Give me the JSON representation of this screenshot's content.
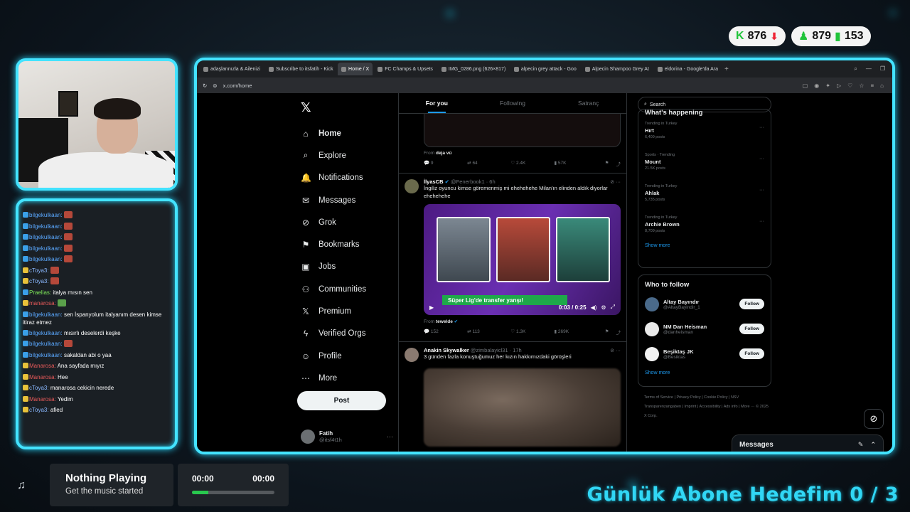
{
  "stats": {
    "kick_count": "876",
    "followers": "879",
    "viewers": "153"
  },
  "chat": {
    "lines": [
      {
        "user": "bilgekulkaan:",
        "text": "",
        "ucls": "u-blue",
        "emote": true
      },
      {
        "user": "bilgekulkaan:",
        "text": "",
        "ucls": "u-blue",
        "emote": true
      },
      {
        "user": "bilgekulkaan:",
        "text": "",
        "ucls": "u-blue",
        "emote": true
      },
      {
        "user": "bilgekulkaan:",
        "text": "",
        "ucls": "u-blue",
        "emote": true
      },
      {
        "user": "bilgekulkaan:",
        "text": "",
        "ucls": "u-blue",
        "emote": true
      },
      {
        "user": "cToya3:",
        "text": "",
        "ucls": "u-lblue",
        "emote": true
      },
      {
        "user": "cToya3:",
        "text": "",
        "ucls": "u-lblue",
        "emote": true
      },
      {
        "user": "Praelias:",
        "text": "italya mısın sen",
        "ucls": "u-green",
        "emote": false
      },
      {
        "user": "manarosa:",
        "text": "",
        "ucls": "u-red",
        "emote": true
      },
      {
        "user": "bilgekulkaan:",
        "text": "sen İspanyolum italyanım desen kimse itiraz etmez",
        "ucls": "u-blue",
        "emote": false,
        "wrap": true
      },
      {
        "user": "bilgekulkaan:",
        "text": "mısırlı deselerdi keşke",
        "ucls": "u-blue",
        "emote": false
      },
      {
        "user": "bilgekulkaan:",
        "text": "",
        "ucls": "u-blue",
        "emote": true
      },
      {
        "user": "bilgekulkaan:",
        "text": "sakaldan abi o yaa",
        "ucls": "u-blue",
        "emote": false
      },
      {
        "user": "Manarosa:",
        "text": "Ana sayfada mıyız",
        "ucls": "u-red",
        "emote": false
      },
      {
        "user": "Manarosa:",
        "text": "Hee",
        "ucls": "u-red",
        "emote": false
      },
      {
        "user": "cToya3:",
        "text": "manarosa cekicin nerede",
        "ucls": "u-lblue",
        "emote": false
      },
      {
        "user": "Manarosa:",
        "text": "Yedim",
        "ucls": "u-red",
        "emote": false
      },
      {
        "user": "cToya3:",
        "text": "afied",
        "ucls": "u-lblue",
        "emote": false
      }
    ]
  },
  "music": {
    "title": "Nothing Playing",
    "subtitle": "Get the music started",
    "time_current": "00:00",
    "time_total": "00:00",
    "progress": 0.2
  },
  "goal_text": "Günlük Abone Hedefim  0 / 3",
  "browser": {
    "tabs": [
      {
        "label": "adaşlarınızla & Ailenizi",
        "active": false
      },
      {
        "label": "Subscribe to itsfatih - Kick",
        "active": false
      },
      {
        "label": "Home / X",
        "active": true
      },
      {
        "label": "FC Champs & Upsets",
        "active": false
      },
      {
        "label": "IMG_0286.png (626×817)",
        "active": false
      },
      {
        "label": "alpecin grey attack - Goo",
        "active": false
      },
      {
        "label": "Alpecin Shampoo Grey At",
        "active": false
      },
      {
        "label": "eldorina - Google'da Ara",
        "active": false
      }
    ],
    "url": "x.com/home"
  },
  "x": {
    "nav": [
      {
        "label": "Home",
        "icon": "home-icon",
        "glyph": "⌂",
        "active": true
      },
      {
        "label": "Explore",
        "icon": "search-icon",
        "glyph": "⌕"
      },
      {
        "label": "Notifications",
        "icon": "bell-icon",
        "glyph": "🔔"
      },
      {
        "label": "Messages",
        "icon": "mail-icon",
        "glyph": "✉"
      },
      {
        "label": "Grok",
        "icon": "grok-icon",
        "glyph": "⊘"
      },
      {
        "label": "Bookmarks",
        "icon": "bookmark-icon",
        "glyph": "⚑"
      },
      {
        "label": "Jobs",
        "icon": "briefcase-icon",
        "glyph": "▣"
      },
      {
        "label": "Communities",
        "icon": "communities-icon",
        "glyph": "⚇"
      },
      {
        "label": "Premium",
        "icon": "x-icon",
        "glyph": "𝕏"
      },
      {
        "label": "Verified Orgs",
        "icon": "lightning-icon",
        "glyph": "ϟ"
      },
      {
        "label": "Profile",
        "icon": "person-icon",
        "glyph": "☺"
      },
      {
        "label": "More",
        "icon": "more-icon",
        "glyph": "⋯"
      }
    ],
    "post_button": "Post",
    "profile": {
      "name": "Fatih",
      "handle": "@itsf4t1h"
    },
    "tabs": [
      "For you",
      "Following",
      "Satranç"
    ],
    "top_post": {
      "from": "deja vú",
      "replies": "9",
      "reposts": "64",
      "likes": "2.4K",
      "views": "57K"
    },
    "post1": {
      "name": "İlyasCB",
      "handle": "@Fenerbook1 · 6h",
      "text": "İngiliz oyuncu kimse göremenmiş mi ehehehehe Milan'ın elinden aldık diyorlar ehehehehe",
      "banner": "Süper Lig'de transfer yarışı!",
      "video_time": "0:03 / 0:25",
      "from": "tewelde",
      "replies": "152",
      "reposts": "113",
      "likes": "1.3K",
      "views": "269K"
    },
    "post2": {
      "name": "Anakin Skywalker",
      "handle": "@zimbalayicl31 · 17h",
      "text": "3 günden fazla konuştuğumuz her kızın hakkımızdaki görüşleri"
    },
    "search_placeholder": "Search",
    "happening_title": "What's happening",
    "trends": [
      {
        "meta": "Trending in Turkey",
        "name": "Hırt",
        "count": "6,409 posts"
      },
      {
        "meta": "Sports · Trending",
        "name": "Mount",
        "count": "21.5K posts"
      },
      {
        "meta": "Trending in Turkey",
        "name": "Ahlak",
        "count": "5,735 posts"
      },
      {
        "meta": "Trending in Turkey",
        "name": "Archie Brown",
        "count": "8,709 posts"
      }
    ],
    "show_more": "Show more",
    "who_to_follow": "Who to follow",
    "suggestions": [
      {
        "name": "Altay Bayındır",
        "handle": "@AltayBayindir_1"
      },
      {
        "name": "NM Dan Heisman",
        "handle": "@danheisman"
      },
      {
        "name": "Beşiktaş JK",
        "handle": "@Besiktas"
      }
    ],
    "follow_label": "Follow",
    "footer": "Terms of Service  |  Privacy Policy  |  Cookie Policy  |  NSV Transparenzangaben  |  Imprint  |  Accessibility  |  Ads info  |  More ···  © 2025 X Corp.",
    "messages_label": "Messages"
  }
}
